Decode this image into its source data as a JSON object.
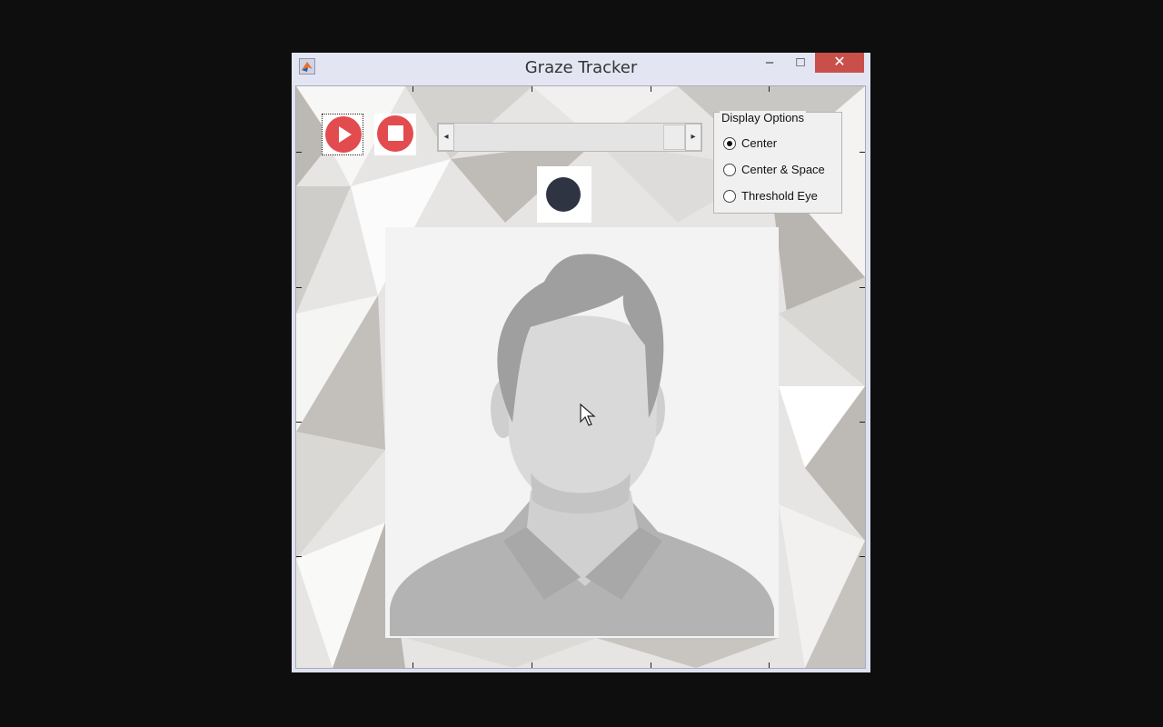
{
  "window": {
    "title": "Graze Tracker",
    "minimize_glyph": "‒",
    "maximize_glyph": "□",
    "close_glyph": "✕"
  },
  "icons": {
    "app": "matlab-app-icon",
    "play": "play-icon",
    "stop": "stop-icon",
    "indicator": "tracking-indicator-dot",
    "avatar": "user-avatar-placeholder"
  },
  "controls": {
    "slider_left_glyph": "◂",
    "slider_right_glyph": "▸",
    "slider_value": 1.0
  },
  "display_options": {
    "legend": "Display Options",
    "options": [
      {
        "label": "Center",
        "selected": true
      },
      {
        "label": "Center & Space",
        "selected": false
      },
      {
        "label": "Threshold Eye",
        "selected": false
      }
    ]
  },
  "colors": {
    "accent_red": "#e24c4f",
    "close_red": "#c9504a",
    "indicator": "#2e3442"
  }
}
